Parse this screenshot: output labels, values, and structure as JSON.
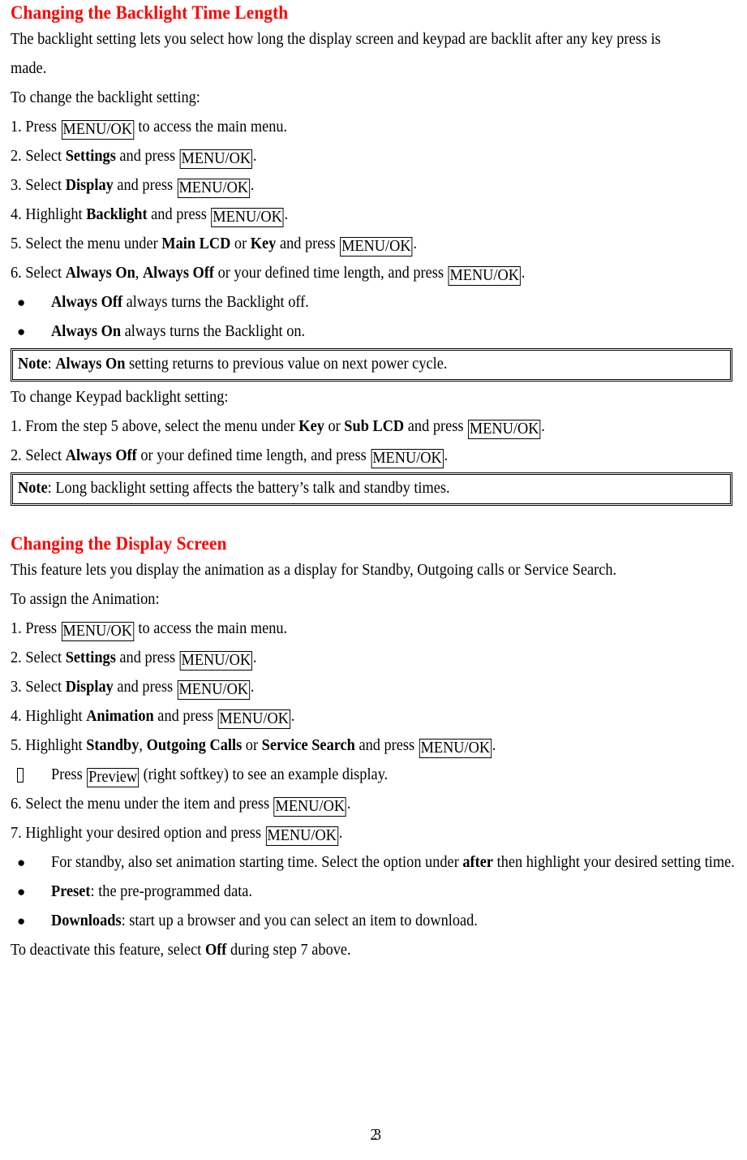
{
  "document": {
    "page_number": "23",
    "heading_color": "#ff0000",
    "body_color": "#000000"
  },
  "section1": {
    "heading": "Changing the Backlight Time Length",
    "intro": "The backlight setting lets you select how long the display screen and keypad are backlit after any key press is made.",
    "lead_in": "To change the backlight setting:",
    "steps": {
      "s1_a": "1. Press ",
      "s1_key": "MENU/OK",
      "s1_b": " to access the main menu.",
      "s2_a": "2. Select ",
      "s2_bold": "Settings",
      "s2_b": " and press ",
      "s2_key": "MENU/OK",
      "s2_c": ".",
      "s3_a": "3. Select ",
      "s3_bold": "Display",
      "s3_b": " and press ",
      "s3_key": "MENU/OK",
      "s3_c": ".",
      "s4_a": "4. Highlight ",
      "s4_bold": "Backlight",
      "s4_b": " and press ",
      "s4_key": "MENU/OK",
      "s4_c": ".",
      "s5_a": "5. Select the menu under ",
      "s5_bold1": "Main LCD",
      "s5_mid": " or ",
      "s5_bold2": "Key",
      "s5_b": " and press ",
      "s5_key": "MENU/OK",
      "s5_c": ".",
      "s6_a": "6. Select ",
      "s6_bold1": "Always On",
      "s6_comma": ", ",
      "s6_bold2": "Always Off",
      "s6_b": " or your defined time length, and press ",
      "s6_key": "MENU/OK",
      "s6_c": "."
    },
    "bullets": [
      {
        "marker": "●",
        "bold": "Always Off",
        "rest": " always turns the Backlight off."
      },
      {
        "marker": "●",
        "bold": "Always On",
        "rest": " always turns the Backlight on."
      }
    ],
    "note1": {
      "label": "Note",
      "colon": ": ",
      "bold": "Always On",
      "rest": " setting returns to previous value on next power cycle."
    },
    "keypad_lead_in": "To change Keypad backlight setting:",
    "keypad_steps": {
      "k1_a": "1. From the step 5 above, select the menu under ",
      "k1_bold1": "Key",
      "k1_mid": " or ",
      "k1_bold2": "Sub LCD",
      "k1_b": " and press ",
      "k1_key": "MENU/OK",
      "k1_c": ".",
      "k2_a": "2. Select ",
      "k2_bold": "Always Off",
      "k2_b": " or your defined time length, and press ",
      "k2_key": "MENU/OK",
      "k2_c": "."
    },
    "note2": {
      "label": "Note",
      "colon": ": ",
      "rest": "Long backlight setting affects the battery’s talk and standby times."
    }
  },
  "section2": {
    "heading": "Changing the Display Screen",
    "intro": "This feature lets you display the animation as a display for Standby, Outgoing calls or Service Search.",
    "lead_in": "To assign the Animation:",
    "steps": {
      "s1_a": "1. Press ",
      "s1_key": "MENU/OK",
      "s1_b": " to access the main menu.",
      "s2_a": "2. Select ",
      "s2_bold": "Settings",
      "s2_b": " and press ",
      "s2_key": "MENU/OK",
      "s2_c": ".",
      "s3_a": "3. Select ",
      "s3_bold": "Display",
      "s3_b": " and press ",
      "s3_key": "MENU/OK",
      "s3_c": ".",
      "s4_a": "4. Highlight ",
      "s4_bold": "Animation",
      "s4_b": " and press ",
      "s4_key": "MENU/OK",
      "s4_c": ".",
      "s5_a": "5. Highlight ",
      "s5_bold1": "Standby",
      "s5_comma": ", ",
      "s5_bold2": "Outgoing Calls",
      "s5_mid": " or ",
      "s5_bold3": "Service Search",
      "s5_b": " and press ",
      "s5_key": "MENU/OK",
      "s5_c": ".",
      "preview_a": "Press ",
      "preview_key": "Preview",
      "preview_b": " (right softkey) to see an example display.",
      "s6_a": "6. Select the menu under the item and press ",
      "s6_key": "MENU/OK",
      "s6_c": ".",
      "s7_a": "7. Highlight your desired option and press ",
      "s7_key": "MENU/OK",
      "s7_c": "."
    },
    "bullets": [
      {
        "marker": "●",
        "text_a": "For standby, also set animation starting time. Select the option under ",
        "bold": "after",
        "text_b": " then highlight your desired setting time."
      },
      {
        "marker": "●",
        "bold": "Preset",
        "rest": ": the pre-programmed data."
      },
      {
        "marker": "●",
        "bold": "Downloads",
        "rest": ": start up a browser and you can select an item to download."
      }
    ],
    "closing_a": "To deactivate this feature, select ",
    "closing_bold": "Off",
    "closing_b": " during step 7 above."
  }
}
